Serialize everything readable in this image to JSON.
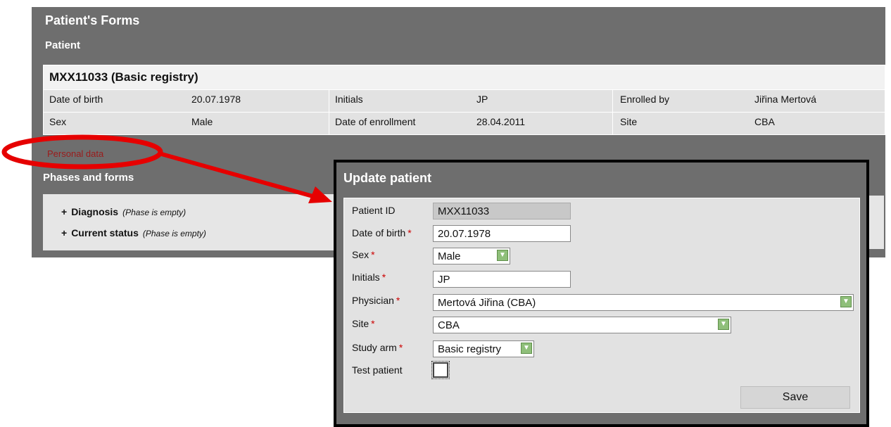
{
  "page": {
    "title": "Patient's Forms",
    "patient_heading": "Patient",
    "phases_heading": "Phases and forms",
    "personal_data_link": "Personal data"
  },
  "patient_card": {
    "title": "MXX11033 (Basic registry)",
    "rows": [
      [
        "Date of birth",
        "20.07.1978",
        "Initials",
        "JP",
        "Enrolled by",
        "Jiřina Mertová"
      ],
      [
        "Sex",
        "Male",
        "Date of enrollment",
        "28.04.2011",
        "Site",
        "CBA"
      ]
    ]
  },
  "phases": [
    {
      "name": "Diagnosis",
      "note": "(Phase is empty)"
    },
    {
      "name": "Current status",
      "note": "(Phase is empty)"
    }
  ],
  "modal": {
    "title": "Update patient",
    "fields": {
      "patient_id": {
        "label": "Patient ID",
        "value": "MXX11033"
      },
      "date_of_birth": {
        "label": "Date of birth",
        "value": "20.07.1978"
      },
      "sex": {
        "label": "Sex",
        "value": "Male"
      },
      "initials": {
        "label": "Initials",
        "value": "JP"
      },
      "physician": {
        "label": "Physician",
        "value": "Mertová Jiřina (CBA)"
      },
      "site": {
        "label": "Site",
        "value": "CBA"
      },
      "study_arm": {
        "label": "Study arm",
        "value": "Basic registry"
      },
      "test_patient": {
        "label": "Test patient",
        "checked": false
      }
    },
    "required_marker": "*",
    "save_label": "Save"
  },
  "colors": {
    "panel_bg": "#6e6e6e",
    "link_red": "#9b1b1b",
    "annotation_red": "#e60000",
    "dropdown_green": "#8fbf7a"
  },
  "icons": {
    "plus": "+",
    "dropdown": "chevron-down-icon"
  }
}
